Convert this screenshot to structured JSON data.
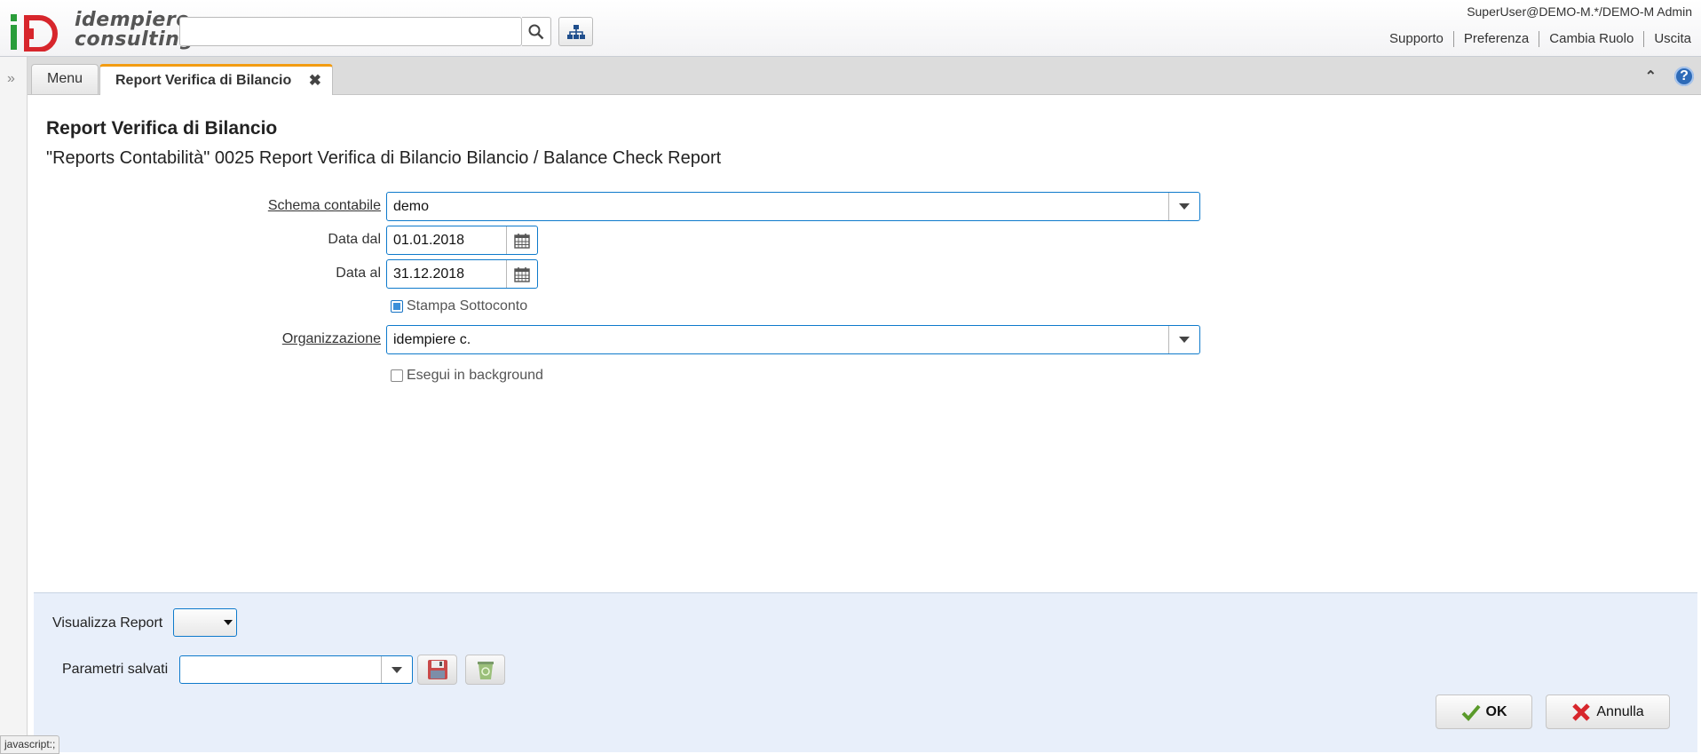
{
  "app": {
    "logo_text_line1": "idempiere",
    "logo_text_line2": "consulting"
  },
  "header": {
    "search_placeholder": "",
    "user": "SuperUser@DEMO-M.*/DEMO-M Admin",
    "links": [
      "Supporto",
      "Preferenza",
      "Cambia Ruolo",
      "Uscita"
    ]
  },
  "tabs": {
    "menu_label": "Menu",
    "active_label": "Report Verifica di Bilancio"
  },
  "form": {
    "title": "Report Verifica di Bilancio",
    "subtitle": "\"Reports Contabilità\" 0025 Report Verifica di Bilancio Bilancio / Balance Check Report",
    "schema_label": "Schema contabile",
    "schema_value": "demo",
    "date_from_label": "Data dal",
    "date_from_value": "01.01.2018",
    "date_to_label": "Data al",
    "date_to_value": "31.12.2018",
    "print_sub_label": "Stampa Sottoconto",
    "print_sub_checked": true,
    "org_label": "Organizzazione",
    "org_value": "idempiere c.",
    "background_label": "Esegui in background",
    "background_checked": false
  },
  "bottom": {
    "report_view_label": "Visualizza Report",
    "report_view_value": "",
    "saved_params_label": "Parametri salvati",
    "saved_params_value": "",
    "ok_label": "OK",
    "cancel_label": "Annulla"
  },
  "status": {
    "tooltip": "javascript:;"
  },
  "colors": {
    "accent": "#0e7acb",
    "active_tab_border": "#f39c12",
    "bottom_panel": "#e8effa"
  }
}
